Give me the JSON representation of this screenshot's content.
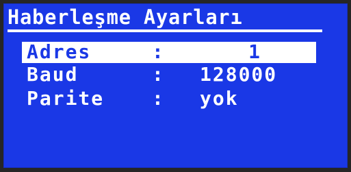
{
  "screen": {
    "title": "Haberleşme Ayarları",
    "colors": {
      "background": "#1a38e6",
      "text": "#ffffff",
      "highlight_bg": "#ffffff",
      "highlight_text": "#1a38e6"
    }
  },
  "settings": [
    {
      "label": "Adres",
      "separator": ":",
      "value": "1",
      "selected": true
    },
    {
      "label": "Baud",
      "separator": ":",
      "value": "128000",
      "selected": false
    },
    {
      "label": "Parite",
      "separator": ":",
      "value": "yok",
      "selected": false
    }
  ]
}
